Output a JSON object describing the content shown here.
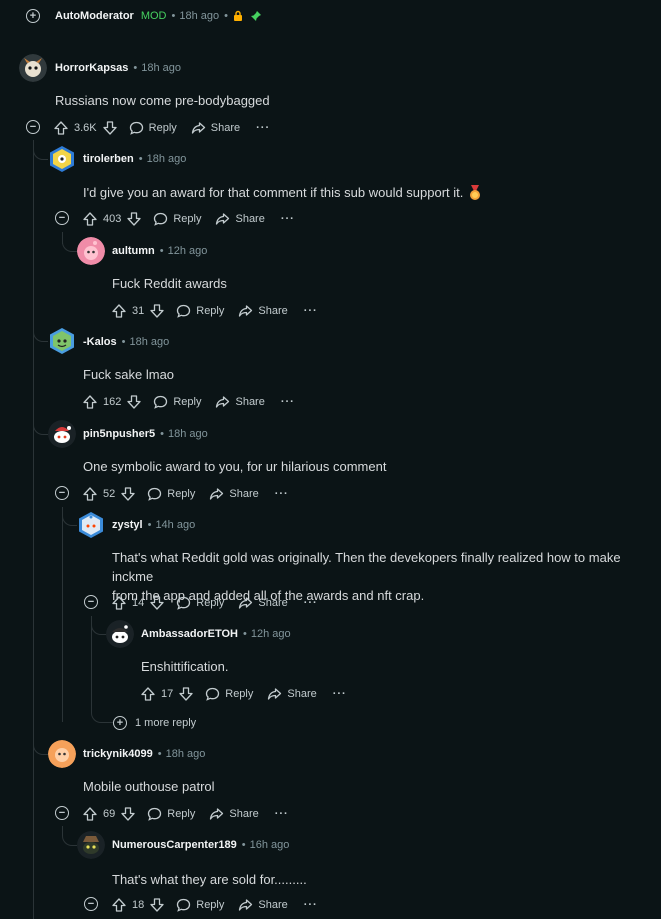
{
  "automod": {
    "username": "AutoModerator",
    "badge": "MOD",
    "time": "18h ago",
    "badge_color": "#46d160",
    "icons": [
      "lock-icon",
      "pin-icon"
    ]
  },
  "actions": {
    "reply": "Reply",
    "share": "Share",
    "more": "···"
  },
  "comments": [
    {
      "user": "HorrorKapsas",
      "time": "18h ago",
      "text": "Russians now come pre-bodybagged",
      "votes": "3.6K"
    },
    {
      "user": "tirolerben",
      "time": "18h ago",
      "text": "I'd give you an award for that comment if this sub would support it.",
      "votes": "403"
    },
    {
      "user": "aultumn",
      "time": "12h ago",
      "text": "Fuck Reddit awards",
      "votes": "31"
    },
    {
      "user": "-Kalos",
      "time": "18h ago",
      "text": "Fuck sake lmao",
      "votes": "162"
    },
    {
      "user": "pin5npusher5",
      "time": "18h ago",
      "text": "One symbolic award to you, for ur hilarious comment",
      "votes": "52"
    },
    {
      "user": "zystyl",
      "time": "14h ago",
      "text_line1": "That's what Reddit gold was originally. Then the devekopers finally realized how to make inckme",
      "text_line2": "from the app and added all of the awards and nft crap.",
      "votes": "14"
    },
    {
      "user": "AmbassadorETOH",
      "time": "12h ago",
      "text": "Enshittification.",
      "votes": "17"
    },
    {
      "user": "trickynik4099",
      "time": "18h ago",
      "text": "Mobile outhouse patrol",
      "votes": "69"
    },
    {
      "user": "NumerousCarpenter189",
      "time": "16h ago",
      "text": "That's what they are sold for.........",
      "votes": "18"
    }
  ],
  "more_replies": "1 more reply"
}
